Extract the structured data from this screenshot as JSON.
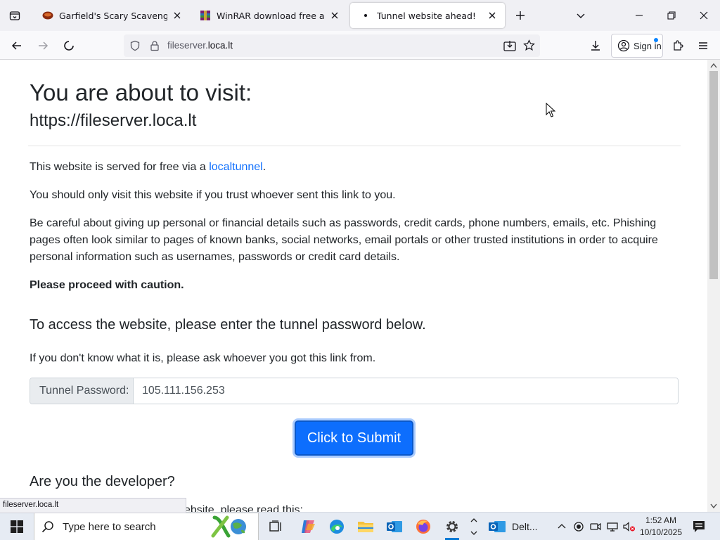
{
  "browser": {
    "tabs": [
      {
        "title": "Garfield's Scary Scavenger Hunt",
        "active": false,
        "favicon": "garfield-icon"
      },
      {
        "title": "WinRAR download free and support",
        "active": false,
        "favicon": "winrar-icon"
      },
      {
        "title": "Tunnel website ahead!",
        "active": true,
        "favicon": "loading-dot-icon"
      }
    ],
    "url_host_dim": "fileserver.",
    "url_host_main": "loca.lt",
    "signin_label": "Sign in",
    "status_tooltip": "fileserver.loca.lt"
  },
  "page": {
    "heading": "You are about to visit:",
    "target_url": "https://fileserver.loca.lt",
    "p1_prefix": "This website is served for free via a ",
    "p1_link": "localtunnel",
    "p1_suffix": ".",
    "p2": "You should only visit this website if you trust whoever sent this link to you.",
    "p3": "Be careful about giving up personal or financial details such as passwords, credit cards, phone numbers, emails, etc. Phishing pages often look similar to pages of known banks, social networks, email portals or other trusted institutions in order to acquire personal information such as usernames, passwords or credit card details.",
    "p4": "Please proceed with caution.",
    "access_heading": "To access the website, please enter the tunnel password below.",
    "access_help": "If you don't know what it is, please ask whoever you got this link from.",
    "password_label": "Tunnel Password:",
    "password_value": "105.111.156.253",
    "submit_label": "Click to Submit",
    "dev_heading": "Are you the developer?",
    "dev_partial": "ebsite, please read this:"
  },
  "taskbar": {
    "search_placeholder": "Type here to search",
    "app_label": "Delt...",
    "time": "1:52 AM",
    "date": "10/10/2025"
  },
  "colors": {
    "link": "#0d6efd",
    "button": "#0d6efd",
    "taskbar_accent": "#0078d4"
  }
}
